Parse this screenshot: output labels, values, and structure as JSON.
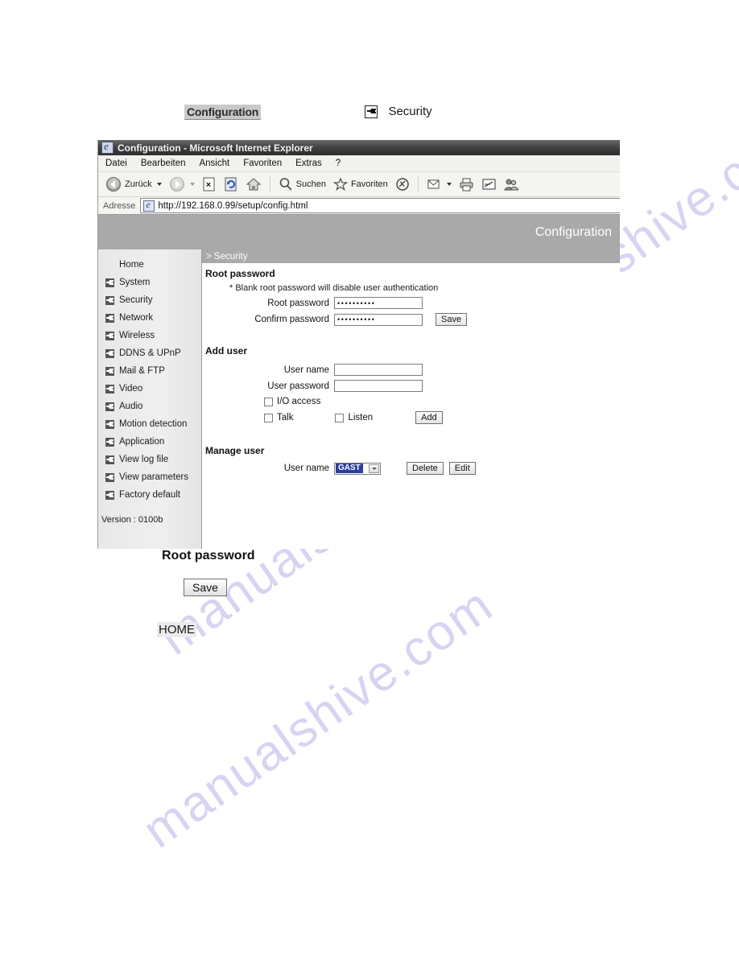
{
  "annotations": {
    "top_highlight": "Configuration",
    "top_arrow_icon": "arrow-right-icon",
    "top_link": "Security",
    "below_heading": "Root password",
    "below_save_button": "Save",
    "below_home_tag": "HOME"
  },
  "watermark": {
    "text": "manualshive.com",
    "color": "#d6d4f2"
  },
  "browser": {
    "title": "Configuration - Microsoft Internet Explorer",
    "title_icon": "ie-page-icon",
    "menu": [
      {
        "label": "Datei",
        "accel": "D"
      },
      {
        "label": "Bearbeiten",
        "accel": "B"
      },
      {
        "label": "Ansicht",
        "accel": "A"
      },
      {
        "label": "Favoriten",
        "accel": "F"
      },
      {
        "label": "Extras",
        "accel": "x"
      },
      {
        "label": "?",
        "accel": ""
      }
    ],
    "toolbar": [
      {
        "icon": "back-arrow-icon",
        "label": "Zurück",
        "has_caret": true
      },
      {
        "icon": "forward-arrow-icon",
        "label": "",
        "has_caret": true
      },
      {
        "icon": "stop-icon",
        "label": ""
      },
      {
        "icon": "refresh-icon",
        "label": ""
      },
      {
        "icon": "home-icon",
        "label": ""
      },
      {
        "icon": "search-icon",
        "label": "Suchen"
      },
      {
        "icon": "favorites-star-icon",
        "label": "Favoriten"
      },
      {
        "icon": "media-icon",
        "label": ""
      },
      {
        "icon": "mail-icon",
        "label": "",
        "has_caret": true
      },
      {
        "icon": "print-icon",
        "label": ""
      },
      {
        "icon": "edit-icon",
        "label": ""
      },
      {
        "icon": "messenger-icon",
        "label": ""
      }
    ],
    "address": {
      "label": "Adresse",
      "icon": "ie-page-icon",
      "url": "http://192.168.0.99/setup/config.html"
    }
  },
  "page": {
    "banner_title": "Configuration",
    "breadcrumb": "> Security",
    "sidebar": {
      "items": [
        {
          "label": "Home",
          "has_arrow": false
        },
        {
          "label": "System",
          "has_arrow": true
        },
        {
          "label": "Security",
          "has_arrow": true
        },
        {
          "label": "Network",
          "has_arrow": true
        },
        {
          "label": "Wireless",
          "has_arrow": true
        },
        {
          "label": "DDNS & UPnP",
          "has_arrow": true
        },
        {
          "label": "Mail & FTP",
          "has_arrow": true
        },
        {
          "label": "Video",
          "has_arrow": true
        },
        {
          "label": "Audio",
          "has_arrow": true
        },
        {
          "label": "Motion detection",
          "has_arrow": true
        },
        {
          "label": "Application",
          "has_arrow": true
        },
        {
          "label": "View log file",
          "has_arrow": true
        },
        {
          "label": "View parameters",
          "has_arrow": true
        },
        {
          "label": "Factory default",
          "has_arrow": true
        }
      ],
      "version": "Version : 0100b"
    },
    "root_password": {
      "heading": "Root password",
      "note": "* Blank root password will disable user authentication",
      "root_label": "Root password",
      "root_value": "••••••••••",
      "confirm_label": "Confirm password",
      "confirm_value": "••••••••••",
      "save_button": "Save"
    },
    "add_user": {
      "heading": "Add user",
      "user_name_label": "User name",
      "user_name_value": "",
      "user_password_label": "User password",
      "user_password_value": "",
      "io_access_label": "I/O access",
      "io_access_checked": false,
      "talk_label": "Talk",
      "talk_checked": false,
      "listen_label": "Listen",
      "listen_checked": false,
      "add_button": "Add"
    },
    "manage_user": {
      "heading": "Manage user",
      "user_name_label": "User name",
      "selected_user": "GAST",
      "delete_button": "Delete",
      "edit_button": "Edit"
    }
  }
}
